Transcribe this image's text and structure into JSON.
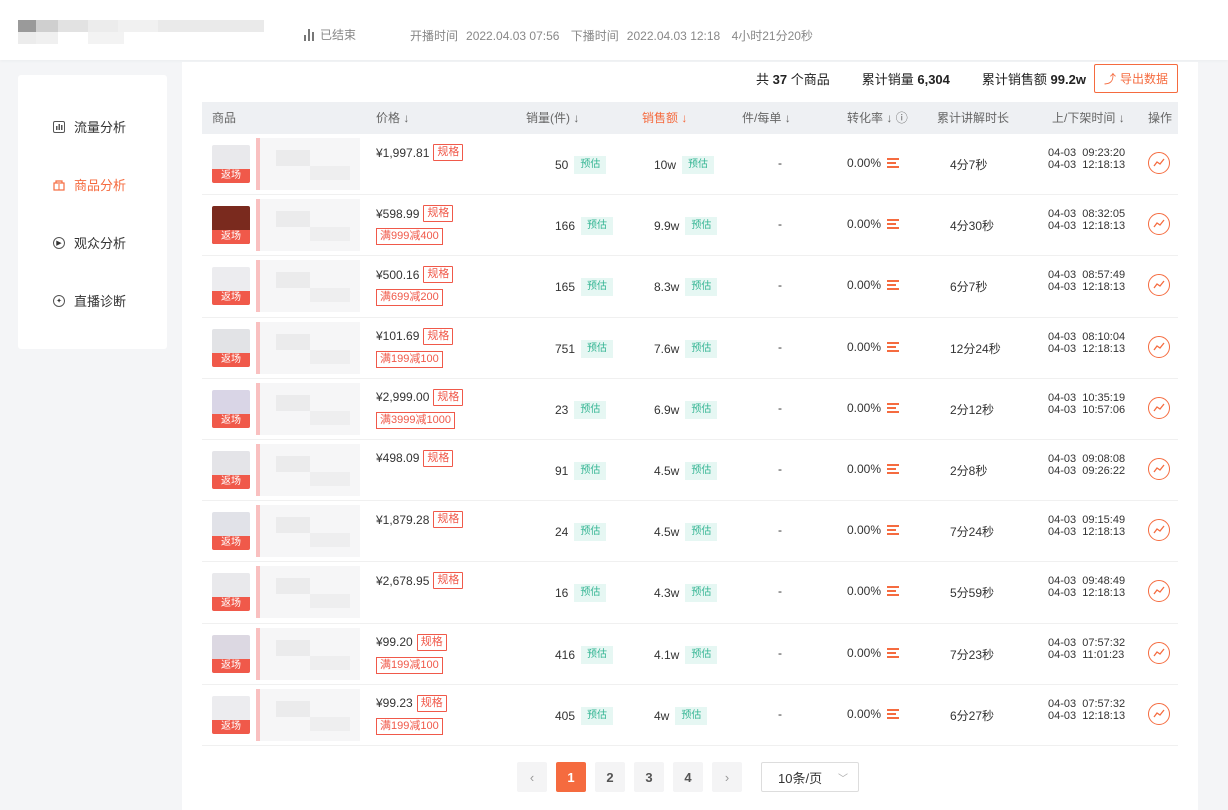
{
  "header": {
    "status": "已结束",
    "start_label": "开播时间",
    "start_time": "2022.04.03 07:56",
    "end_label": "下播时间",
    "end_time": "2022.04.03 12:18",
    "duration": "4小时21分20秒"
  },
  "sidebar": {
    "items": [
      {
        "label": "流量分析",
        "icon": "chart-icon",
        "active": false
      },
      {
        "label": "商品分析",
        "icon": "goods-icon",
        "active": true
      },
      {
        "label": "观众分析",
        "icon": "play-circle-icon",
        "active": false
      },
      {
        "label": "直播诊断",
        "icon": "diagnose-icon",
        "active": false
      }
    ]
  },
  "summary": {
    "total_prefix": "共",
    "total_count": "37",
    "total_suffix": "个商品",
    "sales_label": "累计销量",
    "sales_value": "6,304",
    "revenue_label": "累计销售额",
    "revenue_value": "99.2w",
    "export_label": "导出数据"
  },
  "columns": {
    "product": "商品",
    "price": "价格",
    "sales": "销量(件)",
    "revenue": "销售额",
    "per_order": "件/每单",
    "conversion": "转化率",
    "explain": "累计讲解时长",
    "shelf_time": "上/下架时间",
    "action": "操作"
  },
  "tags": {
    "back": "返场",
    "spec": "规格",
    "estimate": "预估"
  },
  "rows": [
    {
      "price": "¥1,997.81",
      "promo": "",
      "sales": "50",
      "revenue": "10w",
      "per_order": "-",
      "conversion": "0.00%",
      "explain": "4分7秒",
      "times": "04-03  09:23:20\n04-03  12:18:13",
      "thumb_color": "#e9e9ec"
    },
    {
      "price": "¥598.99",
      "promo": "满999减400",
      "sales": "166",
      "revenue": "9.9w",
      "per_order": "-",
      "conversion": "0.00%",
      "explain": "4分30秒",
      "times": "04-03  08:32:05\n04-03  12:18:13",
      "thumb_color": "#7a2a1e"
    },
    {
      "price": "¥500.16",
      "promo": "满699减200",
      "sales": "165",
      "revenue": "8.3w",
      "per_order": "-",
      "conversion": "0.00%",
      "explain": "6分7秒",
      "times": "04-03  08:57:49\n04-03  12:18:13",
      "thumb_color": "#ececef"
    },
    {
      "price": "¥101.69",
      "promo": "满199减100",
      "sales": "751",
      "revenue": "7.6w",
      "per_order": "-",
      "conversion": "0.00%",
      "explain": "12分24秒",
      "times": "04-03  08:10:04\n04-03  12:18:13",
      "thumb_color": "#e2e3e6"
    },
    {
      "price": "¥2,999.00",
      "promo": "满3999减1000",
      "sales": "23",
      "revenue": "6.9w",
      "per_order": "-",
      "conversion": "0.00%",
      "explain": "2分12秒",
      "times": "04-03  10:35:19\n04-03  10:57:06",
      "thumb_color": "#d9d5e6"
    },
    {
      "price": "¥498.09",
      "promo": "",
      "sales": "91",
      "revenue": "4.5w",
      "per_order": "-",
      "conversion": "0.00%",
      "explain": "2分8秒",
      "times": "04-03  09:08:08\n04-03  09:26:22",
      "thumb_color": "#e4e4e8"
    },
    {
      "price": "¥1,879.28",
      "promo": "",
      "sales": "24",
      "revenue": "4.5w",
      "per_order": "-",
      "conversion": "0.00%",
      "explain": "7分24秒",
      "times": "04-03  09:15:49\n04-03  12:18:13",
      "thumb_color": "#e1e2e8"
    },
    {
      "price": "¥2,678.95",
      "promo": "",
      "sales": "16",
      "revenue": "4.3w",
      "per_order": "-",
      "conversion": "0.00%",
      "explain": "5分59秒",
      "times": "04-03  09:48:49\n04-03  12:18:13",
      "thumb_color": "#e9e9ec"
    },
    {
      "price": "¥99.20",
      "promo": "满199减100",
      "sales": "416",
      "revenue": "4.1w",
      "per_order": "-",
      "conversion": "0.00%",
      "explain": "7分23秒",
      "times": "04-03  07:57:32\n04-03  11:01:23",
      "thumb_color": "#dcd8e2"
    },
    {
      "price": "¥99.23",
      "promo": "满199减100",
      "sales": "405",
      "revenue": "4w",
      "per_order": "-",
      "conversion": "0.00%",
      "explain": "6分27秒",
      "times": "04-03  07:57:32\n04-03  12:18:13",
      "thumb_color": "#ececef"
    }
  ],
  "pagination": {
    "pages": [
      "1",
      "2",
      "3",
      "4"
    ],
    "current": "1",
    "page_size": "10条/页"
  },
  "colors": {
    "accent": "#f56b3f",
    "tag_red": "#f0594a",
    "estimate_green": "#34b593"
  }
}
